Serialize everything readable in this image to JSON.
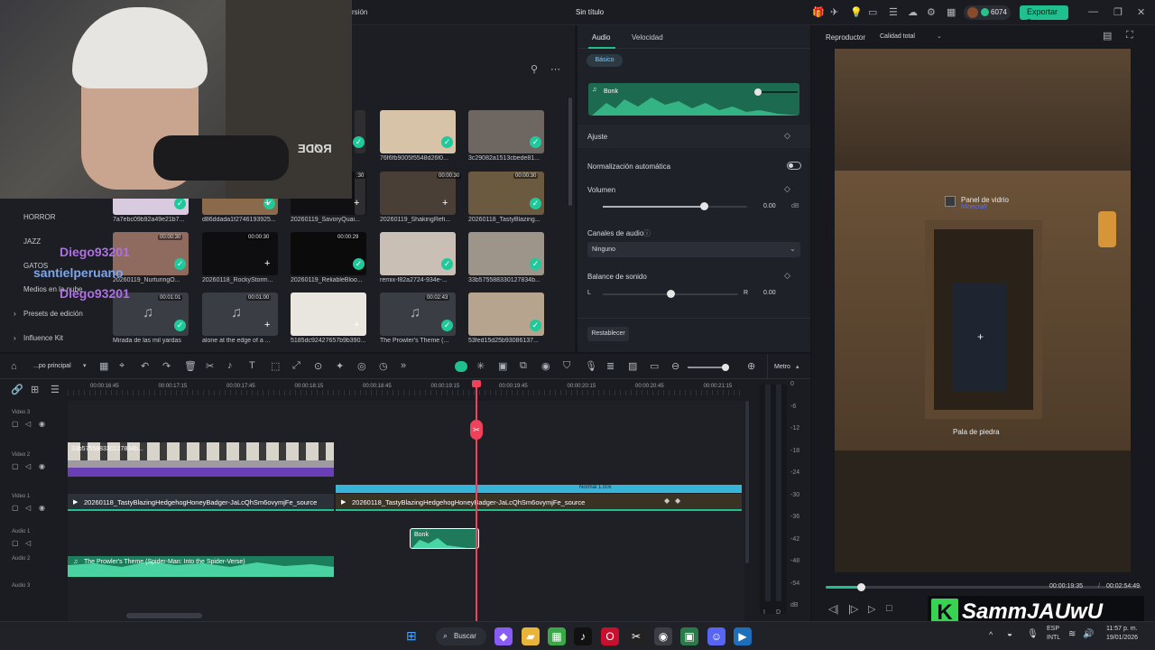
{
  "app": {
    "version_tab": "rsión",
    "title": "Sin título",
    "credits": "6074",
    "export_label": "Exportar"
  },
  "webcam": {
    "mic_brand": "RØDE"
  },
  "media": {
    "sidebar": [
      "HORROR",
      "JAZZ",
      "GATOS",
      "Medios en la nube",
      "Presets de edición",
      "Influence Kit"
    ],
    "thumbs": [
      {
        "label": "76f6fb9005f5548d26f0...",
        "dur": ""
      },
      {
        "label": "3c29082a1513cbede81...",
        "dur": ""
      },
      {
        "label": "7a7ebc09b92a49e21b7...",
        "dur": ""
      },
      {
        "label": "d86ddada1f2746193925...",
        "dur": ""
      },
      {
        "label": "20260119_SavoryQuai...",
        "dur": ""
      },
      {
        "label": "20260119_ShakingRefi...",
        "dur": "00:00:30"
      },
      {
        "label": "20260118_TastyBlazing...",
        "dur": "00:00:30"
      },
      {
        "label": "20260119_NurturingO...",
        "dur": "00:00:30"
      },
      {
        "label": "20260118_RockyStorm...",
        "dur": "00:00:30"
      },
      {
        "label": "20260119_ReliableBloo...",
        "dur": "00:00:29"
      },
      {
        "label": "remix-f82a2724-934e-...",
        "dur": ""
      },
      {
        "label": "33b575588330127834b...",
        "dur": ""
      },
      {
        "label": "Mirada de las mil yardas",
        "dur": "00:01:01"
      },
      {
        "label": "alone at the edge of a ...",
        "dur": "00:01:00"
      },
      {
        "label": "5185dc92427657b9b390...",
        "dur": ""
      },
      {
        "label": "The Prowler's Theme (...",
        "dur": "00:02:43"
      },
      {
        "label": "53fed15d25b93086137...",
        "dur": ""
      }
    ],
    "partial_durations": [
      ":30",
      ":29"
    ]
  },
  "chat_overlay": [
    "Diego93201",
    "santielperuano",
    "Diego93201"
  ],
  "props": {
    "tabs": [
      "Audio",
      "Velocidad"
    ],
    "subtab": "Básico",
    "clip_name": "Bonk",
    "section": "Ajuste",
    "normalize_label": "Normalización automática",
    "volume_label": "Volumen",
    "volume_value": "0.00",
    "volume_unit": "dB",
    "volume_level": 0.7,
    "channels_label": "Canales de audio",
    "channels_value": "Ninguno",
    "balance_label": "Balance de sonido",
    "balance_l": "L",
    "balance_r": "R",
    "balance_value": "0.00",
    "balance_level": 0.5,
    "reset_label": "Restablecer"
  },
  "preview": {
    "tab": "Reproductor",
    "quality": "Calidad total",
    "game_sign": "Panel de vidrio",
    "game_sub": "Minecraft",
    "game_item": "Pala de piedra",
    "current_time": "00:00:19:35",
    "total_time": "00:02:54:49",
    "progress": 0.11,
    "streamer_tag": "SammJAUwU"
  },
  "timeline": {
    "sequence": "...po principal",
    "meter_label": "Metro",
    "ruler": [
      "00:00:16:45",
      "00:00:17:15",
      "00:00:17:45",
      "00:00:18:15",
      "00:00:18:45",
      "00:00:19:15",
      "00:00:19:45",
      "00:00:20:15",
      "00:00:20:45",
      "00:00:21:15"
    ],
    "tracks": [
      "Video 3",
      "Video 2",
      "Video 1",
      "Audio 1",
      "Audio 2",
      "Audio 3"
    ],
    "clip_video1_a": "20260118_TastyBlazingHedgehogHoneyBadger-JaLcQhSm6ovymjFe_source",
    "clip_video1_b": "20260118_TastyBlazingHedgehogHoneyBadger-JaLcQhSm6ovymjFe_source",
    "clip_video2": "33b575588330127834b...",
    "speed_badge": "Normal 1.00x",
    "clip_audio1": "Bonk",
    "clip_audio2": "The Prowler's Theme (Spider-Man: Into the Spider-Verse)",
    "db_scale": [
      "0",
      "-6",
      "-12",
      "-18",
      "-24",
      "-30",
      "-36",
      "-42",
      "-48",
      "-54",
      "dB"
    ],
    "lr": [
      "I",
      "D"
    ]
  },
  "taskbar": {
    "search": "Buscar",
    "lang": "ESP",
    "layout": "INTL",
    "time": "11:57 p. m.",
    "date": "19/01/2026"
  }
}
